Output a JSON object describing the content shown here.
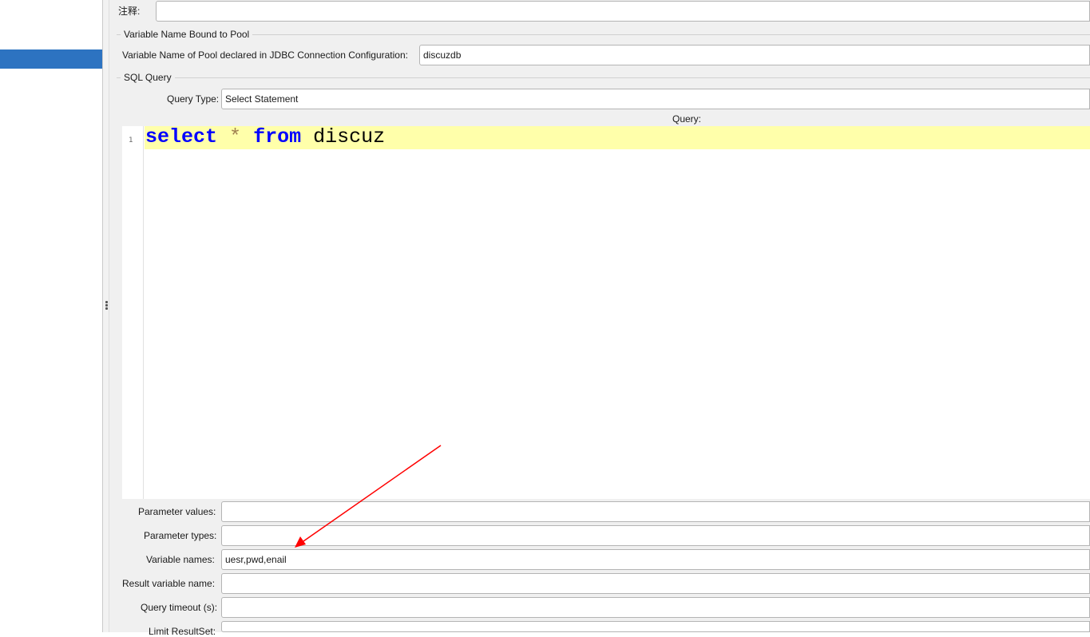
{
  "comment": {
    "label": "注释:",
    "value": ""
  },
  "pool_section": {
    "title": "Variable Name Bound to Pool",
    "pool_label": "Variable Name of Pool declared in JDBC Connection Configuration:",
    "pool_value": "discuzdb"
  },
  "sql_section": {
    "title": "SQL Query",
    "query_type_label": "Query Type:",
    "query_type_value": "Select Statement",
    "query_label": "Query:"
  },
  "editor": {
    "line_number": "1",
    "tokens": {
      "select": "select",
      "star": "*",
      "from": "from",
      "table": "discuz"
    },
    "current_line_color": "#ffffaa",
    "keyword_color": "#0000ff"
  },
  "params": {
    "parameter_values_label": "Parameter values:",
    "parameter_values_value": "",
    "parameter_types_label": "Parameter types:",
    "parameter_types_value": "",
    "variable_names_label": "Variable names:",
    "variable_names_value": "uesr,pwd,enail",
    "result_variable_label": "Result variable name:",
    "result_variable_value": "",
    "query_timeout_label": "Query timeout (s):",
    "query_timeout_value": "",
    "limit_resultset_label": "Limit ResultSet:",
    "limit_resultset_value": ""
  },
  "tree": {
    "selected_color": "#2d73c1"
  },
  "annotation": {
    "arrow_color": "#ff0000",
    "icon": "red-arrow-icon"
  }
}
